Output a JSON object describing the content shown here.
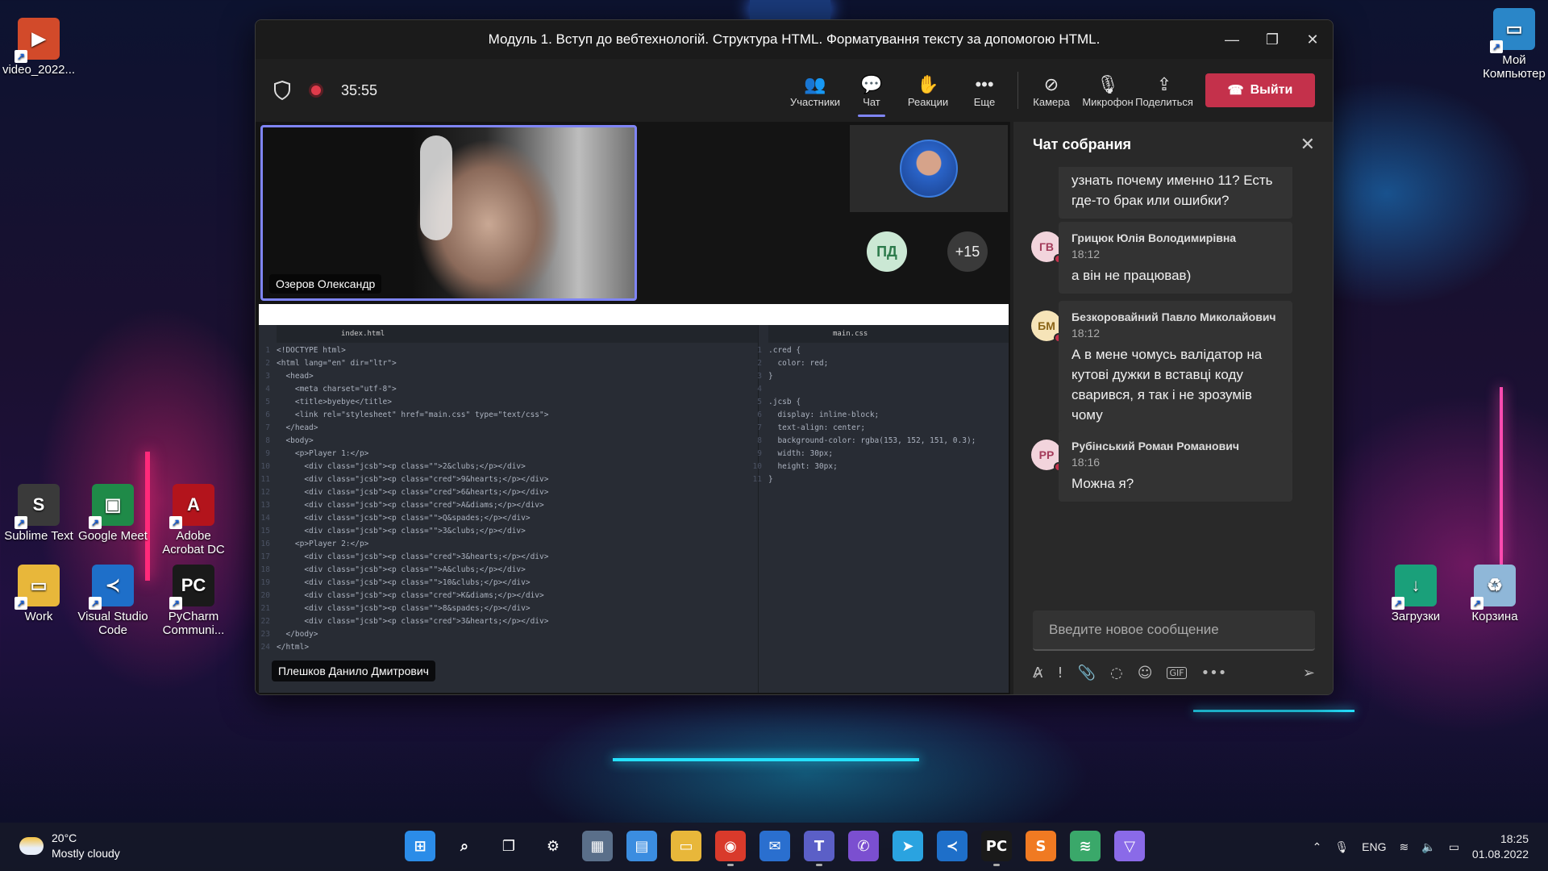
{
  "desktop": {
    "icons_left": [
      {
        "label": "video_2022...",
        "color": "#d24a2a",
        "glyph": "▶"
      },
      {
        "label": "Sublime Text",
        "color": "#3a3a3a",
        "glyph": "S"
      },
      {
        "label": "Google Meet",
        "color": "#1f8a48",
        "glyph": "▣"
      },
      {
        "label": "Adobe Acrobat DC",
        "color": "#b3141c",
        "glyph": "A"
      },
      {
        "label": "Work",
        "color": "#e8b73a",
        "glyph": "▭"
      },
      {
        "label": "Visual Studio Code",
        "color": "#1e6fc9",
        "glyph": "≺"
      },
      {
        "label": "PyCharm Communi...",
        "color": "#1a1a1a",
        "glyph": "PC"
      }
    ],
    "icons_right": [
      {
        "label": "Мой Компьютер",
        "color": "#2a86c8",
        "glyph": "▭"
      },
      {
        "label": "Загрузки",
        "color": "#1aa07a",
        "glyph": "↓"
      },
      {
        "label": "Корзина",
        "color": "#8fb7d8",
        "glyph": "♻"
      }
    ]
  },
  "window": {
    "title": "Модуль 1. Вступ до вебтехнологій. Структура HTML. Форматування тексту за допомогою HTML.",
    "controls": [
      "—",
      "❐",
      "✕"
    ]
  },
  "toolbar": {
    "timer": "35:55",
    "buttons": [
      {
        "label": "Участники",
        "icon": "people-icon",
        "glyph": "👥"
      },
      {
        "label": "Чат",
        "icon": "chat-icon",
        "glyph": "💬"
      },
      {
        "label": "Реакции",
        "icon": "hand-icon",
        "glyph": "✋"
      },
      {
        "label": "Еще",
        "icon": "more-icon",
        "glyph": "•••"
      }
    ],
    "media": [
      {
        "label": "Камера",
        "icon": "camera-off-icon",
        "glyph": "⊘"
      },
      {
        "label": "Микрофон",
        "icon": "mic-off-icon",
        "glyph": "🎙"
      },
      {
        "label": "Поделиться",
        "icon": "share-icon",
        "glyph": "⇪"
      }
    ],
    "leave_label": "Выйти",
    "accent": "#7f85f5",
    "leave_color": "#c4314b"
  },
  "stage": {
    "main_participant": "Озеров Олександр",
    "avatar_initials": "ПД",
    "overflow_count": "+15",
    "presenter": "Плешков Данило Дмитрович",
    "editor": {
      "html_tab": "index.html",
      "css_tab": "main.css",
      "html_lines": [
        "<!DOCTYPE html>",
        "<html lang=\"en\" dir=\"ltr\">",
        "  <head>",
        "    <meta charset=\"utf-8\">",
        "    <title>byebye</title>",
        "    <link rel=\"stylesheet\" href=\"main.css\" type=\"text/css\">",
        "  </head>",
        "  <body>",
        "    <p>Player 1:</p>",
        "      <div class=\"jcsb\"><p class=\"\">2&clubs;</p></div>",
        "      <div class=\"jcsb\"><p class=\"cred\">9&hearts;</p></div>",
        "      <div class=\"jcsb\"><p class=\"cred\">6&hearts;</p></div>",
        "      <div class=\"jcsb\"><p class=\"cred\">A&diams;</p></div>",
        "      <div class=\"jcsb\"><p class=\"\">Q&spades;</p></div>",
        "      <div class=\"jcsb\"><p class=\"\">3&clubs;</p></div>",
        "    <p>Player 2:</p>",
        "      <div class=\"jcsb\"><p class=\"cred\">3&hearts;</p></div>",
        "      <div class=\"jcsb\"><p class=\"\">A&clubs;</p></div>",
        "      <div class=\"jcsb\"><p class=\"\">10&clubs;</p></div>",
        "      <div class=\"jcsb\"><p class=\"cred\">K&diams;</p></div>",
        "      <div class=\"jcsb\"><p class=\"\">8&spades;</p></div>",
        "      <div class=\"jcsb\"><p class=\"cred\">3&hearts;</p></div>",
        "  </body>",
        "</html>"
      ],
      "css_lines": [
        ".cred {",
        "  color: red;",
        "}",
        "",
        ".jcsb {",
        "  display: inline-block;",
        "  text-align: center;",
        "  background-color: rgba(153, 152, 151, 0.3);",
        "  width: 30px;",
        "  height: 30px;",
        "}"
      ]
    }
  },
  "chat": {
    "title": "Чат собрания",
    "messages": [
      {
        "initials": "",
        "name": "",
        "time": "",
        "text": "узнать почему именно 11? Есть где-то брак или ошибки?",
        "avatar_bg": "#f2d4dc",
        "avatar_fg": "#a33b5a"
      },
      {
        "initials": "ГВ",
        "name": "Грицюк Юлія Володимирівна",
        "time": "18:12",
        "text": "а він не працював)",
        "avatar_bg": "#f2d4dc",
        "avatar_fg": "#a33b5a"
      },
      {
        "initials": "БМ",
        "name": "Безкоровайний Павло Миколайович",
        "time": "18:12",
        "text": "А в мене чомусь валідатор на кутові дужки в вставці коду сварився, я так і не зрозумів чому",
        "avatar_bg": "#f6e4b8",
        "avatar_fg": "#8a6417"
      },
      {
        "initials": "РР",
        "name": "Рубінський Роман Романович",
        "time": "18:16",
        "text": "Можна я?",
        "avatar_bg": "#f2d4dc",
        "avatar_fg": "#a33b5a"
      }
    ],
    "compose_placeholder": "Введите новое сообщение",
    "tools": [
      "format-icon",
      "priority-icon",
      "attach-icon",
      "loop-icon",
      "emoji-icon",
      "gif-icon",
      "more-icon"
    ],
    "tool_glyphs": [
      "A̷",
      "!",
      "📎",
      "◌",
      "☺",
      "GIF",
      "•••"
    ]
  },
  "taskbar": {
    "weather_temp": "20°C",
    "weather_desc": "Mostly cloudy",
    "apps": [
      {
        "name": "start-icon",
        "color": "#2b8ce8",
        "glyph": "⊞"
      },
      {
        "name": "search-icon",
        "color": "transparent",
        "glyph": "⌕"
      },
      {
        "name": "task-view-icon",
        "color": "transparent",
        "glyph": "❐"
      },
      {
        "name": "settings-icon",
        "color": "transparent",
        "glyph": "⚙"
      },
      {
        "name": "calculator-icon",
        "color": "#5a6f8a",
        "glyph": "▦"
      },
      {
        "name": "notepad-icon",
        "color": "#3b8de0",
        "glyph": "▤"
      },
      {
        "name": "explorer-icon",
        "color": "#e8b73a",
        "glyph": "▭"
      },
      {
        "name": "chrome-icon",
        "color": "#d93a2b",
        "glyph": "◉"
      },
      {
        "name": "outlook-icon",
        "color": "#2a6fcf",
        "glyph": "✉"
      },
      {
        "name": "teams-icon",
        "color": "#5b5fc7",
        "glyph": "T"
      },
      {
        "name": "viber-icon",
        "color": "#7b4fd0",
        "glyph": "✆"
      },
      {
        "name": "telegram-icon",
        "color": "#2aa3e0",
        "glyph": "➤"
      },
      {
        "name": "vscode-icon",
        "color": "#1e6fc9",
        "glyph": "≺"
      },
      {
        "name": "pycharm-icon",
        "color": "#1a1a1a",
        "glyph": "PC"
      },
      {
        "name": "sublime-icon",
        "color": "#f07a22",
        "glyph": "S"
      },
      {
        "name": "layers-icon",
        "color": "#3aa86a",
        "glyph": "≋"
      },
      {
        "name": "vpn-icon",
        "color": "#8a6ae8",
        "glyph": "▽"
      }
    ],
    "language": "ENG",
    "time": "18:25",
    "date": "01.08.2022"
  }
}
